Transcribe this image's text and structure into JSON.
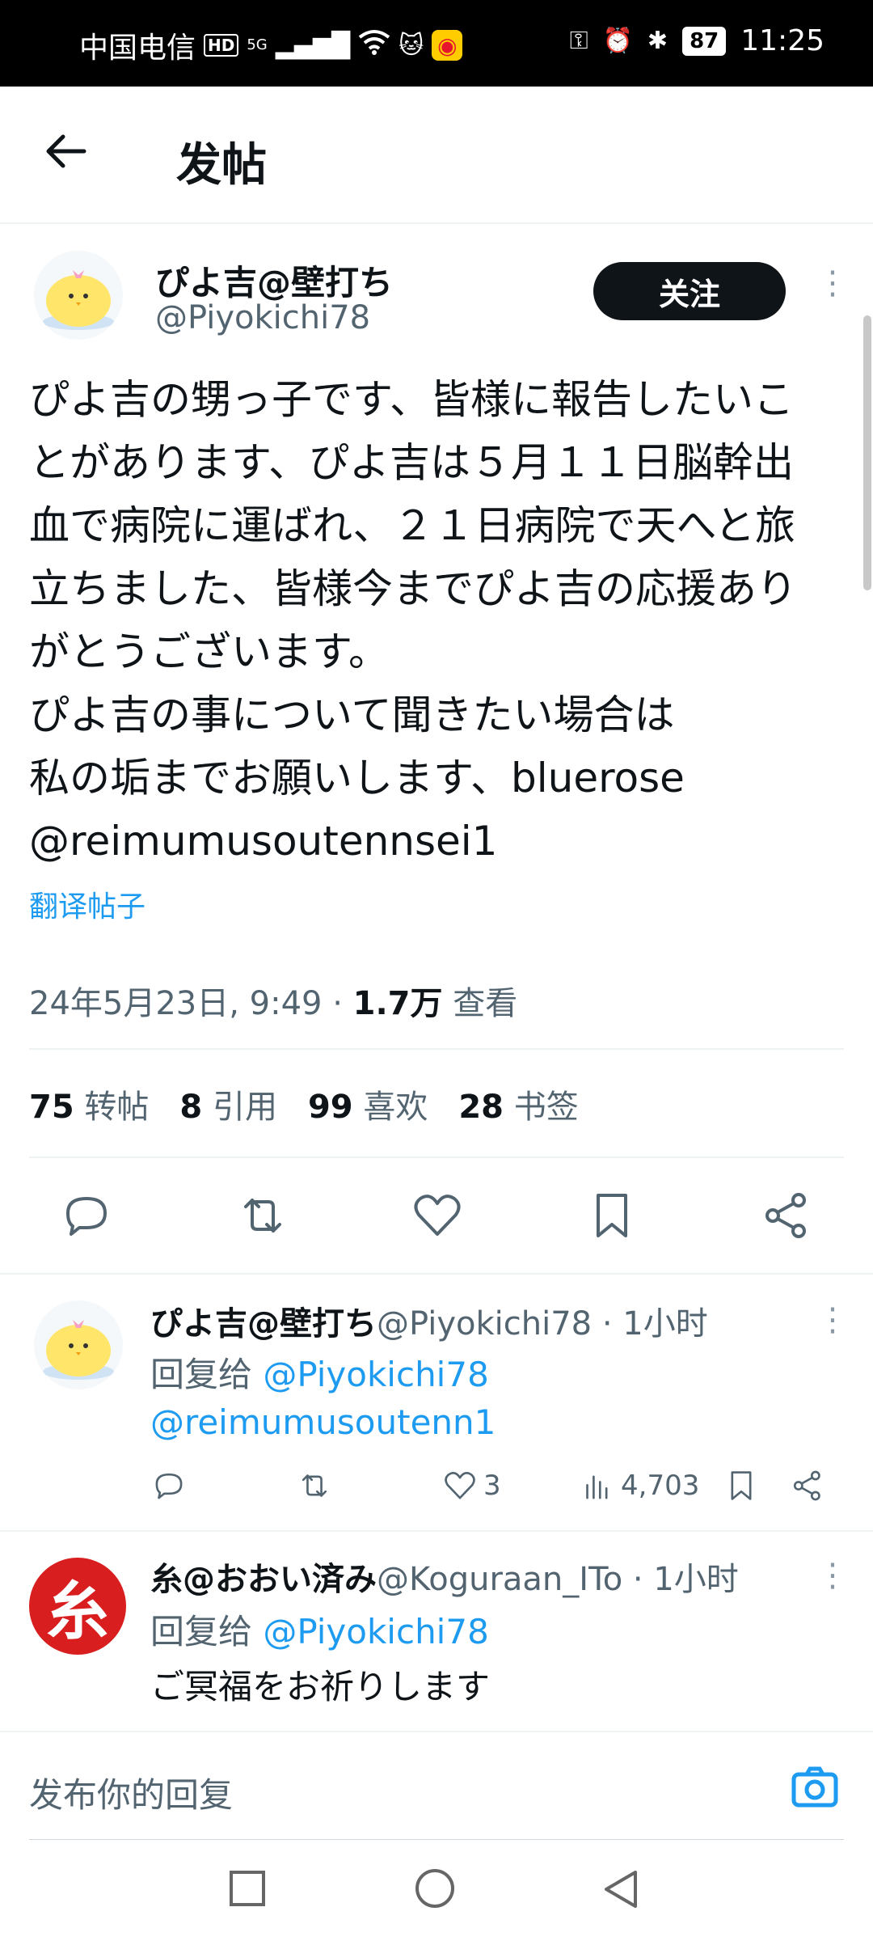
{
  "status": {
    "carrier": "中国电信",
    "hd": "HD",
    "network": "5G",
    "battery": "87",
    "time": "11:25"
  },
  "header": {
    "title": "发帖"
  },
  "tweet": {
    "display_name": "ぴよ吉@壁打ち",
    "handle": "@Piyokichi78",
    "follow_label": "关注",
    "text": "ぴよ吉の甥っ子です、皆様に報告したいことがあります、ぴよ吉は５月１１日脳幹出血で病院に運ばれ、２１日病院で天へと旅立ちました、皆様今までぴよ吉の応援ありがとうございます。\nぴよ吉の事について聞きたい場合は\n私の垢までお願いします、bluerose\n@reimumusoutennsei1",
    "translate_label": "翻译帖子",
    "timestamp": "24年5月23日, 9:49 · ",
    "views_count": "1.7万",
    "views_label": " 查看",
    "stats": [
      {
        "count": "75",
        "label": "转帖"
      },
      {
        "count": "8",
        "label": "引用"
      },
      {
        "count": "99",
        "label": "喜欢"
      },
      {
        "count": "28",
        "label": "书签"
      }
    ]
  },
  "replies": [
    {
      "display_name": "ぴよ吉@壁打ち",
      "handle": "@Piyokichi78",
      "time": " · 1小时",
      "reply_to_prefix": "回复给 ",
      "reply_to": "@Piyokichi78",
      "text": "@reimumusoutenn1",
      "likes": "3",
      "views": "4,703"
    },
    {
      "display_name": "糸@おおい済み",
      "handle": "@Koguraan_ITo",
      "time": " · 1小时",
      "reply_to_prefix": "回复给 ",
      "reply_to": "@Piyokichi78",
      "text": "ご冥福をお祈りします",
      "avatar_char": "糸"
    }
  ],
  "composer": {
    "placeholder": "发布你的回复"
  },
  "colors": {
    "accent": "#1d9bf0",
    "text": "#0f1419",
    "muted": "#536471"
  }
}
